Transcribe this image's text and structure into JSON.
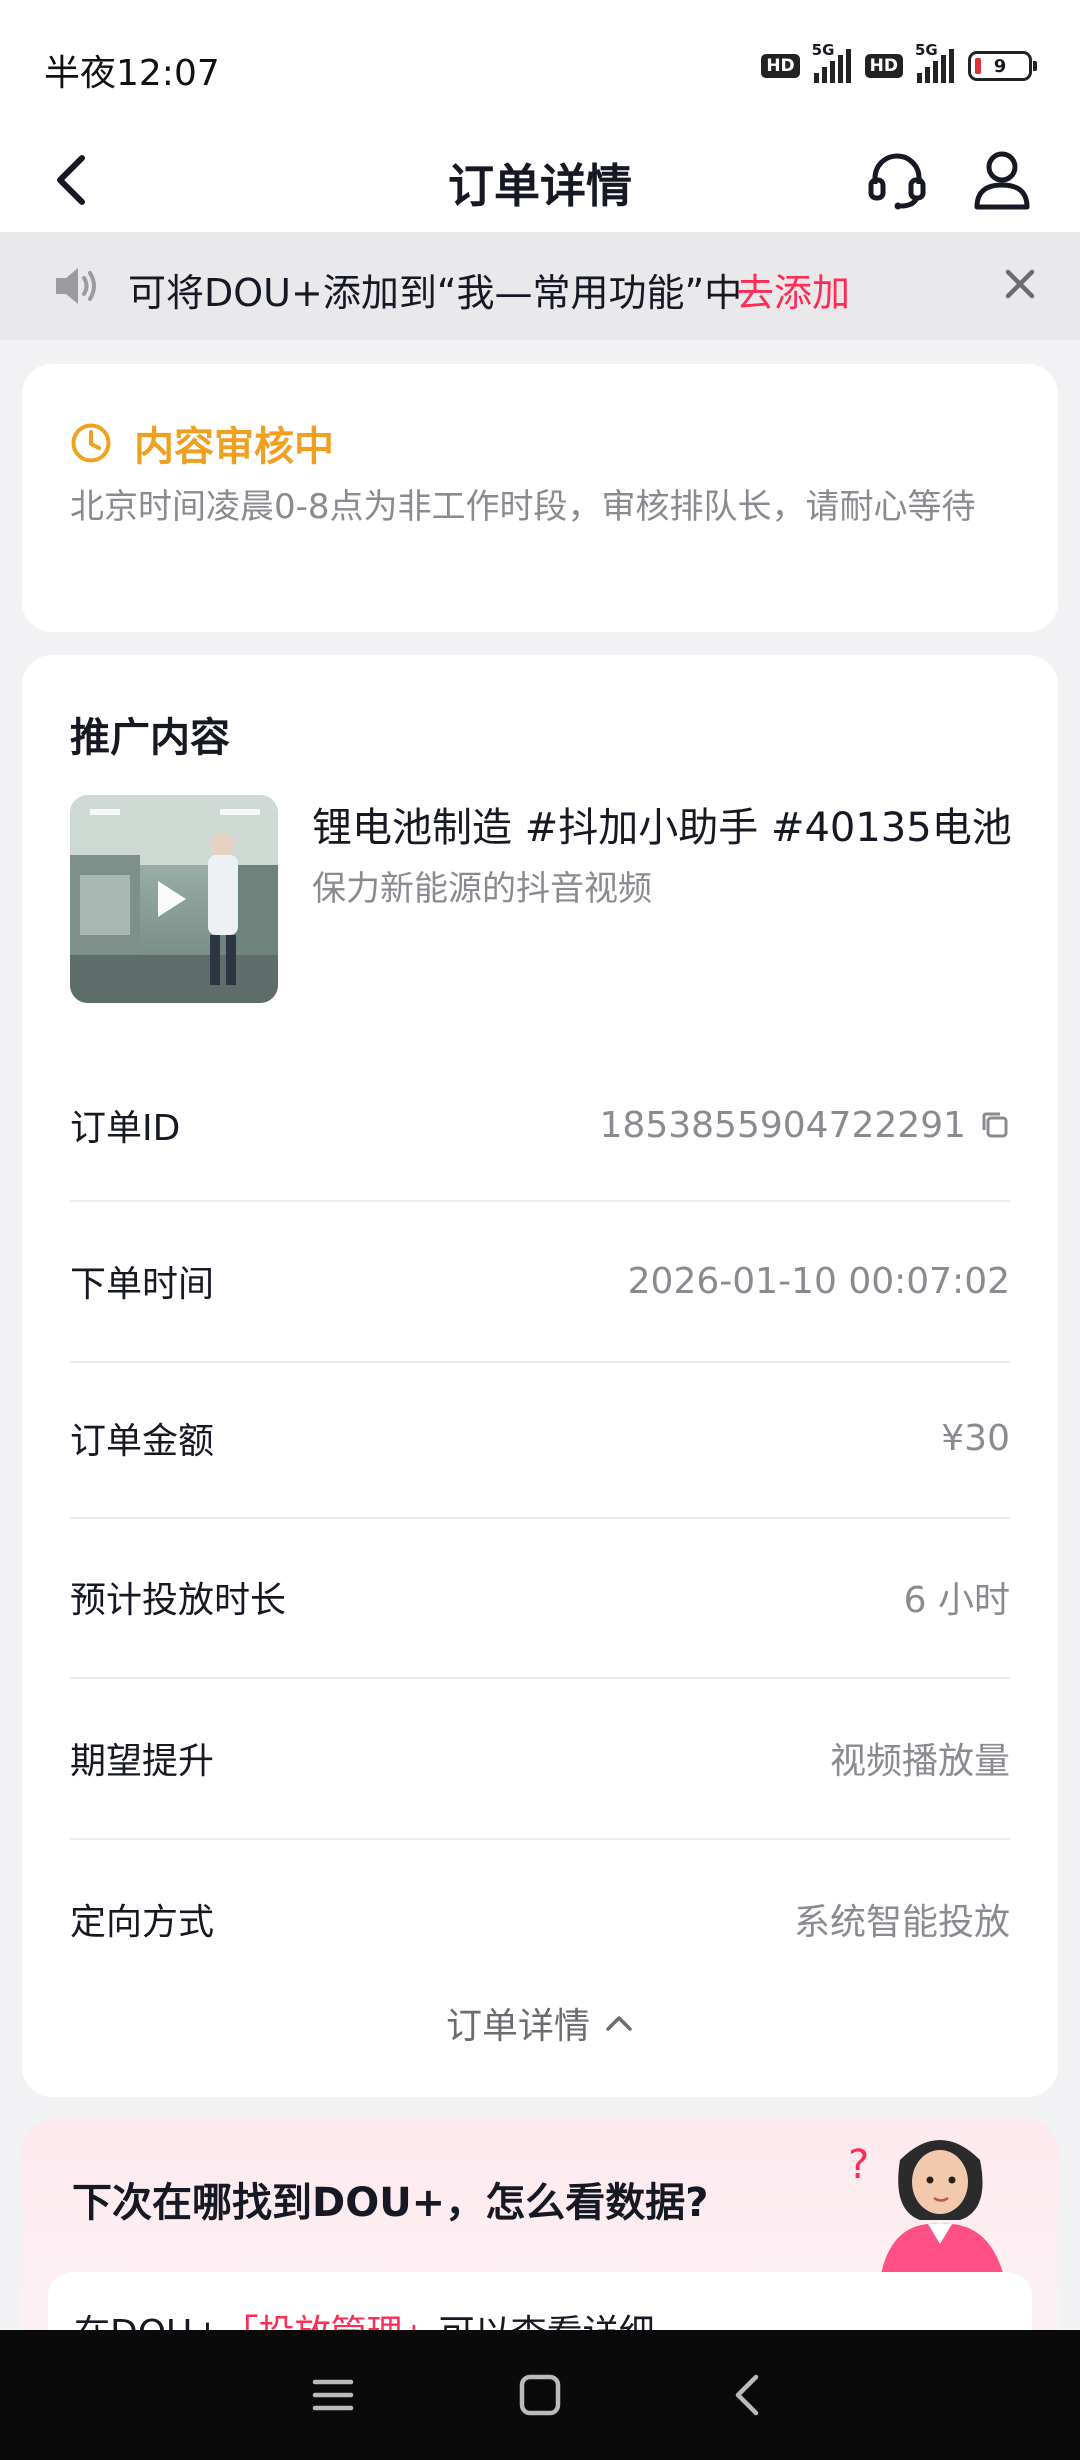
{
  "status_bar": {
    "time": "半夜12:07",
    "hd_badge": "HD",
    "network": "5G",
    "battery": "9"
  },
  "nav": {
    "title": "订单详情",
    "icons": [
      "back-arrow-icon",
      "headset-icon",
      "user-icon"
    ]
  },
  "notice": {
    "text": "可将DOU+添加到“我—常用功能”中",
    "action": "去添加",
    "icons": [
      "speaker-icon",
      "close-icon"
    ]
  },
  "review_status": {
    "title": "内容审核中",
    "description": "北京时间凌晨0-8点为非工作时段，审核排队长，请耐心等待",
    "color": "#f0a020"
  },
  "promo": {
    "section_title": "推广内容",
    "video_title": "锂电池制造 #抖加小助手 #40135电池",
    "video_subtitle": "保力新能源的抖音视频"
  },
  "order_rows": [
    {
      "label": "订单ID",
      "value": "1853855904722291"
    },
    {
      "label": "下单时间",
      "value": "2026-01-10 00:07:02"
    },
    {
      "label": "订单金额",
      "value": "¥30"
    },
    {
      "label": "预计投放时长",
      "value": "6 小时"
    },
    {
      "label": "期望提升",
      "value": "视频播放量"
    },
    {
      "label": "定向方式",
      "value": "系统智能投放"
    }
  ],
  "more_details_label": "订单详情",
  "help": {
    "title": "下次在哪找到DOU+，怎么看数据?",
    "line_prefix": "在DOU+",
    "line_highlight": "「投放管理」",
    "line_suffix": "可以查看详细"
  },
  "colors": {
    "accent": "#fe2c55",
    "warning": "#f0a020",
    "muted_text": "#8a8b91"
  }
}
